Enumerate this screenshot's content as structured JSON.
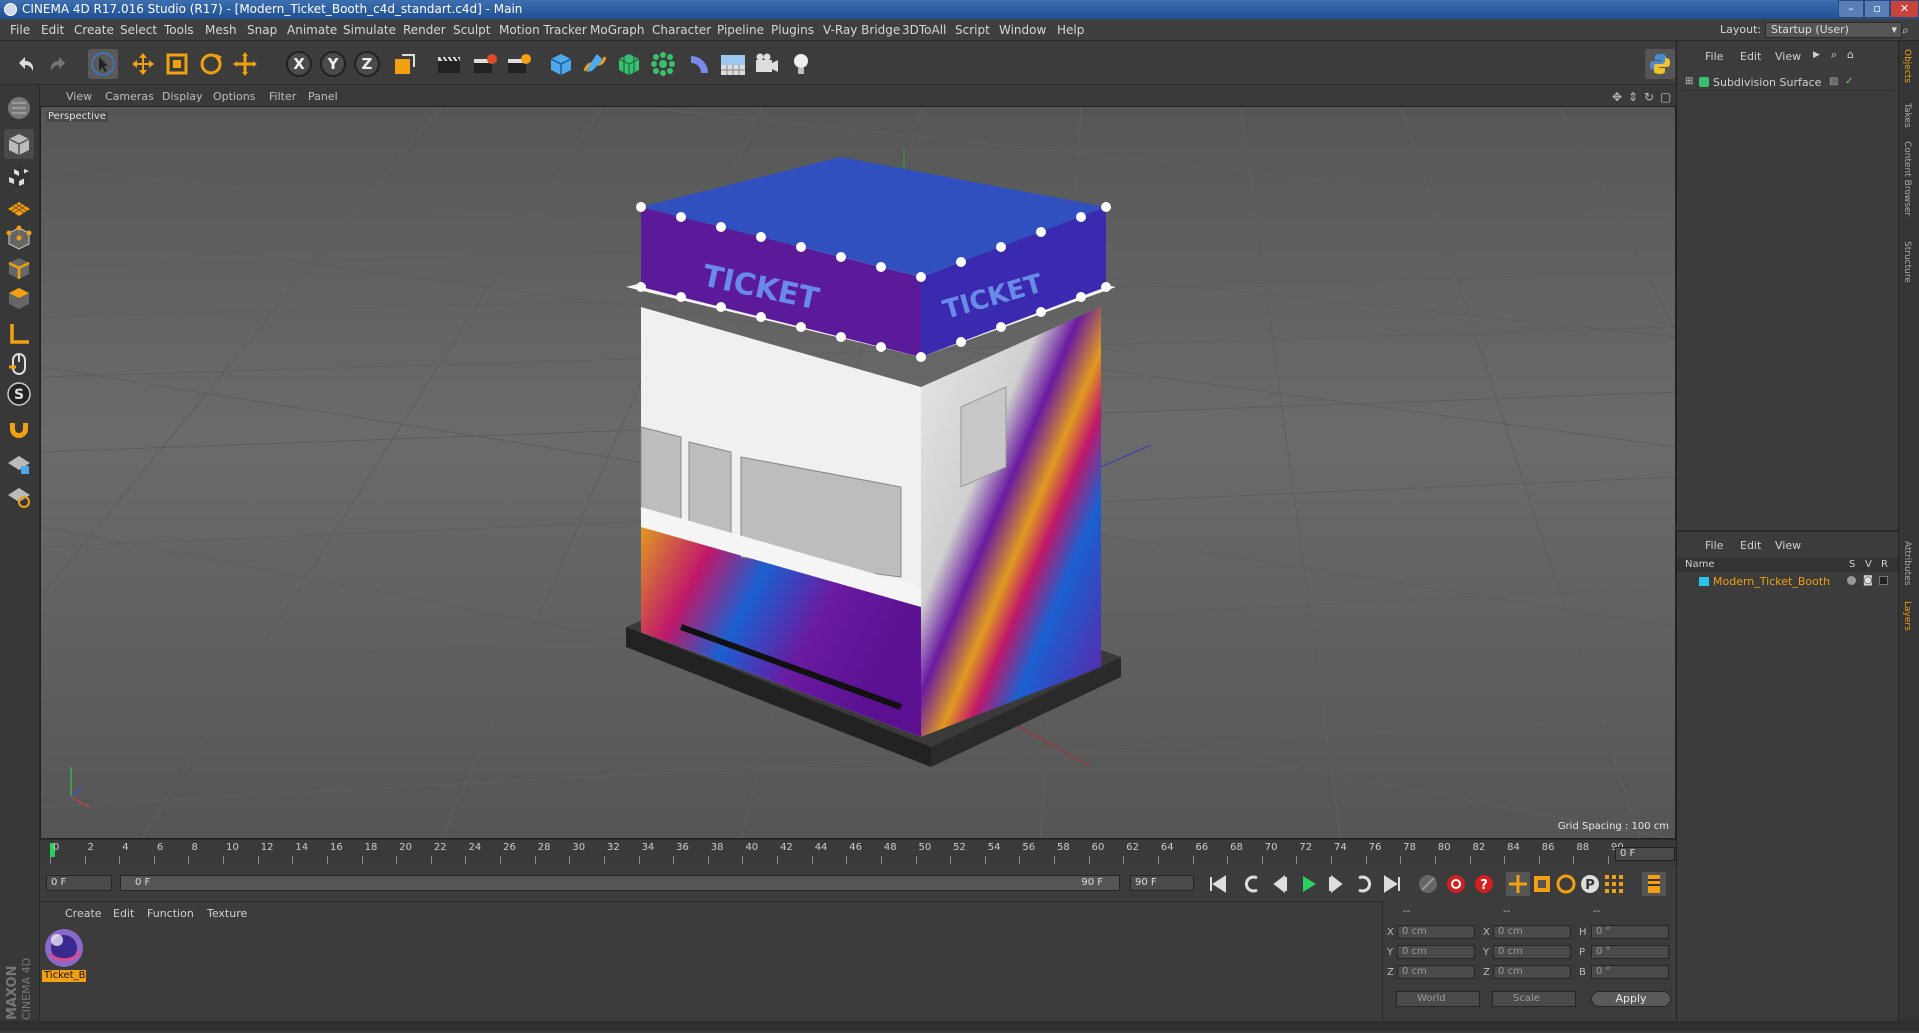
{
  "window": {
    "title": "CINEMA 4D R17.016 Studio (R17) - [Modern_Ticket_Booth_c4d_standart.c4d] - Main"
  },
  "menubar": {
    "items": [
      "File",
      "Edit",
      "Create",
      "Select",
      "Tools",
      "Mesh",
      "Snap",
      "Animate",
      "Simulate",
      "Render",
      "Sculpt",
      "Motion Tracker",
      "MoGraph",
      "Character",
      "Pipeline",
      "Plugins",
      "V-Ray Bridge",
      "3DToAll",
      "Script",
      "Window",
      "Help"
    ],
    "layout_label": "Layout:",
    "layout_value": "Startup (User)"
  },
  "toolbar": {
    "icons": [
      "undo-icon",
      "redo-icon",
      "select-icon",
      "move-icon",
      "scale-icon",
      "rotate-icon",
      "live-select-icon",
      "x-axis-lock",
      "y-axis-lock",
      "z-axis-lock",
      "coordinate-system-icon",
      "render-view-icon",
      "render-picture-viewer-icon",
      "edit-render-settings-icon",
      "cube-primitive-icon",
      "pen-spline-icon",
      "subdivision-icon",
      "array-icon",
      "deformer-icon",
      "floor-icon",
      "camera-icon",
      "light-icon"
    ],
    "axis_x": "X",
    "axis_y": "Y",
    "axis_z": "Z",
    "python_icon": "python-icon"
  },
  "viewport": {
    "menu": [
      "View",
      "Cameras",
      "Display",
      "Options",
      "Filter",
      "Panel"
    ],
    "label": "Perspective",
    "grid_spacing": "Grid Spacing : 100 cm",
    "booth_sign": "TICKET"
  },
  "timeline": {
    "ticks": [
      "0",
      "2",
      "4",
      "6",
      "8",
      "10",
      "12",
      "14",
      "16",
      "18",
      "20",
      "22",
      "24",
      "26",
      "28",
      "30",
      "32",
      "34",
      "36",
      "38",
      "40",
      "42",
      "44",
      "46",
      "48",
      "50",
      "52",
      "54",
      "56",
      "58",
      "60",
      "62",
      "64",
      "66",
      "68",
      "70",
      "72",
      "74",
      "76",
      "78",
      "80",
      "82",
      "84",
      "86",
      "88",
      "90"
    ],
    "current_frame": "0 F"
  },
  "transport": {
    "start_frame": "0 F",
    "range_start": "0 F",
    "range_end": "90 F",
    "end_frame": "90 F"
  },
  "material_manager": {
    "menu": [
      "Create",
      "Edit",
      "Function",
      "Texture"
    ],
    "material_name": "Ticket_B"
  },
  "brand": {
    "maxon": "MAXON",
    "cinema": "CINEMA 4D"
  },
  "coordinates": {
    "header": [
      "--",
      "--",
      "--"
    ],
    "rows": [
      {
        "axis": "X",
        "pos": "0 cm",
        "size_axis": "X",
        "size": "0 cm",
        "rot_axis": "H",
        "rot": "0 °"
      },
      {
        "axis": "Y",
        "pos": "0 cm",
        "size_axis": "Y",
        "size": "0 cm",
        "rot_axis": "P",
        "rot": "0 °"
      },
      {
        "axis": "Z",
        "pos": "0 cm",
        "size_axis": "Z",
        "size": "0 cm",
        "rot_axis": "B",
        "rot": "0 °"
      }
    ],
    "mode_world": "World",
    "mode_scale": "Scale",
    "apply": "Apply"
  },
  "object_manager": {
    "menu": [
      "File",
      "Edit",
      "View"
    ],
    "object": "Subdivision Surface"
  },
  "layer_manager": {
    "menu": [
      "File",
      "Edit",
      "View"
    ],
    "col_name": "Name",
    "col_s": "S",
    "col_v": "V",
    "col_r": "R",
    "layer": "Modern_Ticket_Booth",
    "layer_color": "#27c3e6"
  },
  "side_tabs": [
    "Objects",
    "Takes",
    "Content Browser",
    "Structure",
    "Attributes",
    "Layers"
  ],
  "colors": {
    "accent": "#f0a010",
    "object_text": "#f0a010"
  }
}
